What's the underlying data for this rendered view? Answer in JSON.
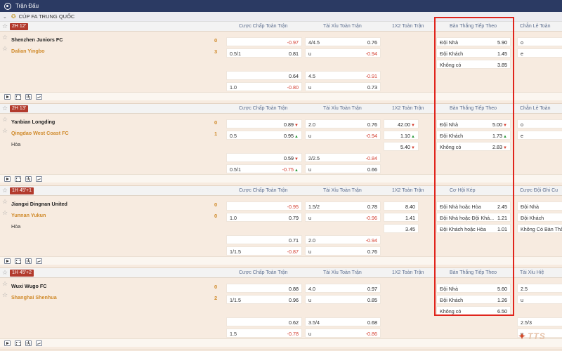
{
  "topbar": {
    "title": "Trận Đấu"
  },
  "league": {
    "name": "CÚP FA TRUNG QUỐC"
  },
  "matches": [
    {
      "time": "2H 12'",
      "home": "Shenzhen Juniors FC",
      "away": "Dalian Yingbo",
      "draw": "",
      "home_score": "0",
      "away_score": "3",
      "headers": {
        "hcp": "Cược Chấp Toàn Trận",
        "ou": "Tài Xỉu Toàn Trận",
        "x12": "1X2 Toàn Trận",
        "next": "Bàn Thắng Tiếp Theo",
        "extra": "Chẵn Lẻ Toàn"
      },
      "hcp": [
        {
          "l": "",
          "r": "-0.97",
          "neg": true,
          "arrow": ""
        },
        {
          "l": "0.5/1",
          "r": "0.81",
          "neg": false,
          "arrow": ""
        },
        {
          "l": "",
          "r": "0.64",
          "neg": false,
          "arrow": ""
        },
        {
          "l": "1.0",
          "r": "-0.80",
          "neg": true,
          "arrow": ""
        }
      ],
      "ou": [
        {
          "l": "4/4.5",
          "r": "0.76",
          "neg": false,
          "arrow": ""
        },
        {
          "l": "u",
          "r": "-0.94",
          "neg": true,
          "arrow": ""
        },
        {
          "l": "4.5",
          "r": "-0.91",
          "neg": true,
          "arrow": ""
        },
        {
          "l": "u",
          "r": "0.73",
          "neg": false,
          "arrow": ""
        }
      ],
      "x12": [],
      "next": [
        {
          "l": "Đội Nhà",
          "r": "5.90",
          "arrow": ""
        },
        {
          "l": "Đội Khách",
          "r": "1.45",
          "arrow": ""
        },
        {
          "l": "Không có",
          "r": "3.85",
          "arrow": ""
        }
      ],
      "extra": [
        {
          "l": "o"
        },
        {
          "l": "e"
        }
      ]
    },
    {
      "time": "2H 13'",
      "home": "Yanbian Longding",
      "away": "Qingdao West Coast FC",
      "draw": "Hòa",
      "home_score": "0",
      "away_score": "1",
      "headers": {
        "hcp": "Cược Chấp Toàn Trận",
        "ou": "Tài Xỉu Toàn Trận",
        "x12": "1X2 Toàn Trận",
        "next": "Bàn Thắng Tiếp Theo",
        "extra": "Chẵn Lẻ Toàn"
      },
      "hcp": [
        {
          "l": "",
          "r": "0.89",
          "neg": false,
          "arrow": "dn"
        },
        {
          "l": "0.5",
          "r": "0.95",
          "neg": false,
          "arrow": "up"
        },
        {
          "l": "",
          "r": "0.59",
          "neg": false,
          "arrow": "dn"
        },
        {
          "l": "0.5/1",
          "r": "-0.75",
          "neg": true,
          "arrow": "up"
        }
      ],
      "ou": [
        {
          "l": "2.0",
          "r": "0.76",
          "neg": false,
          "arrow": ""
        },
        {
          "l": "u",
          "r": "-0.94",
          "neg": true,
          "arrow": ""
        },
        {
          "l": "2/2.5",
          "r": "-0.84",
          "neg": true,
          "arrow": ""
        },
        {
          "l": "u",
          "r": "0.66",
          "neg": false,
          "arrow": ""
        }
      ],
      "x12": [
        {
          "r": "42.00",
          "arrow": "dn"
        },
        {
          "r": "1.10",
          "arrow": "up"
        },
        {
          "r": "5.40",
          "arrow": "dn"
        }
      ],
      "next": [
        {
          "l": "Đội Nhà",
          "r": "5.00",
          "arrow": "dn"
        },
        {
          "l": "Đội Khách",
          "r": "1.73",
          "arrow": "up"
        },
        {
          "l": "Không có",
          "r": "2.83",
          "arrow": "dn"
        }
      ],
      "extra": [
        {
          "l": "o"
        },
        {
          "l": "e"
        }
      ]
    },
    {
      "time": "1H 45'+1",
      "home": "Jiangxi Dingnan United",
      "away": "Yunnan Yukun",
      "draw": "Hòa",
      "home_score": "0",
      "away_score": "0",
      "headers": {
        "hcp": "Cược Chấp Toàn Trận",
        "ou": "Tài Xỉu Toàn Trận",
        "x12": "1X2 Toàn Trận",
        "next": "Cơ Hội Kép",
        "extra": "Cược Đội Ghi Cu"
      },
      "hcp": [
        {
          "l": "",
          "r": "-0.95",
          "neg": true,
          "arrow": ""
        },
        {
          "l": "1.0",
          "r": "0.79",
          "neg": false,
          "arrow": ""
        },
        {
          "l": "",
          "r": "0.71",
          "neg": false,
          "arrow": ""
        },
        {
          "l": "1/1.5",
          "r": "-0.87",
          "neg": true,
          "arrow": ""
        }
      ],
      "ou": [
        {
          "l": "1.5/2",
          "r": "0.78",
          "neg": false,
          "arrow": ""
        },
        {
          "l": "u",
          "r": "-0.96",
          "neg": true,
          "arrow": ""
        },
        {
          "l": "2.0",
          "r": "-0.94",
          "neg": true,
          "arrow": ""
        },
        {
          "l": "u",
          "r": "0.76",
          "neg": false,
          "arrow": ""
        }
      ],
      "x12": [
        {
          "r": "8.40",
          "arrow": ""
        },
        {
          "r": "1.41",
          "arrow": ""
        },
        {
          "r": "3.45",
          "arrow": ""
        }
      ],
      "next": [
        {
          "l": "Đội Nhà hoặc Hòa",
          "r": "2.45",
          "arrow": ""
        },
        {
          "l": "Đội Nhà hoặc Đội Khá...",
          "r": "1.21",
          "arrow": ""
        },
        {
          "l": "Đội Khách hoặc Hòa",
          "r": "1.01",
          "arrow": ""
        }
      ],
      "extra": [
        {
          "l": "Đội Nhà"
        },
        {
          "l": "Đội Khách"
        },
        {
          "l": "Không Có Bàn Thắ"
        }
      ]
    },
    {
      "time": "1H 45'+2",
      "home": "Wuxi Wugo FC",
      "away": "Shanghai Shenhua",
      "draw": "",
      "home_score": "0",
      "away_score": "2",
      "headers": {
        "hcp": "Cược Chấp Toàn Trận",
        "ou": "Tài Xỉu Toàn Trận",
        "x12": "1X2 Toàn Trận",
        "next": "Bàn Thắng Tiếp Theo",
        "extra": "Tài Xỉu Hiệ"
      },
      "hcp": [
        {
          "l": "",
          "r": "0.88",
          "neg": false,
          "arrow": ""
        },
        {
          "l": "1/1.5",
          "r": "0.96",
          "neg": false,
          "arrow": ""
        },
        {
          "l": "",
          "r": "0.62",
          "neg": false,
          "arrow": ""
        },
        {
          "l": "1.5",
          "r": "-0.78",
          "neg": true,
          "arrow": ""
        }
      ],
      "ou": [
        {
          "l": "4.0",
          "r": "0.97",
          "neg": false,
          "arrow": ""
        },
        {
          "l": "u",
          "r": "0.85",
          "neg": false,
          "arrow": ""
        },
        {
          "l": "3.5/4",
          "r": "0.68",
          "neg": false,
          "arrow": ""
        },
        {
          "l": "u",
          "r": "-0.86",
          "neg": true,
          "arrow": ""
        }
      ],
      "x12": [],
      "next": [
        {
          "l": "Đội Nhà",
          "r": "5.60",
          "arrow": ""
        },
        {
          "l": "Đội Khách",
          "r": "1.26",
          "arrow": ""
        },
        {
          "l": "Không có",
          "r": "6.50",
          "arrow": ""
        }
      ],
      "extra": [
        {
          "l": "2.5"
        },
        {
          "l": "u"
        },
        {
          "l": "2.5/3"
        },
        {
          "l": "u"
        }
      ]
    }
  ],
  "watermark": {
    "text": "TTS"
  },
  "colors": {
    "topbar": "#2b3a63",
    "highlight": "#e0241c",
    "negative": "#d33b2c",
    "away_team": "#d08a2a",
    "time_badge": "#b23a2c"
  }
}
